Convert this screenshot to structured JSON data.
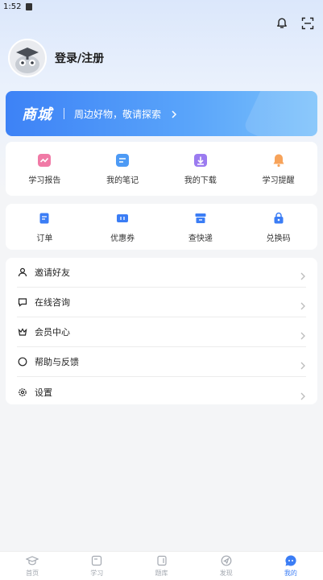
{
  "status_bar": {
    "time": "1:52"
  },
  "profile": {
    "login_label": "登录/注册"
  },
  "mall": {
    "title": "商城",
    "subtitle": "周边好物，敬请探索"
  },
  "quick_grid": [
    {
      "label": "学习报告",
      "icon": "report-icon",
      "color": "#f07aa6"
    },
    {
      "label": "我的笔记",
      "icon": "notes-icon",
      "color": "#4d9af5"
    },
    {
      "label": "我的下载",
      "icon": "download-icon",
      "color": "#9b7bf0"
    },
    {
      "label": "学习提醒",
      "icon": "bell-icon",
      "color": "#f7a35a"
    }
  ],
  "order_grid": [
    {
      "label": "订单",
      "icon": "order-icon"
    },
    {
      "label": "优惠券",
      "icon": "coupon-icon"
    },
    {
      "label": "查快递",
      "icon": "express-icon"
    },
    {
      "label": "兑换码",
      "icon": "redeem-icon"
    }
  ],
  "menu": [
    {
      "label": "邀请好友",
      "icon": "person-icon"
    },
    {
      "label": "在线咨询",
      "icon": "chat-icon"
    },
    {
      "label": "会员中心",
      "icon": "crown-icon"
    },
    {
      "label": "帮助与反馈",
      "icon": "help-icon"
    },
    {
      "label": "设置",
      "icon": "settings-icon"
    }
  ],
  "tabs": [
    {
      "label": "首页",
      "icon": "graduation-cap-icon",
      "active": false
    },
    {
      "label": "学习",
      "icon": "study-icon",
      "active": false
    },
    {
      "label": "题库",
      "icon": "question-bank-icon",
      "active": false
    },
    {
      "label": "发现",
      "icon": "discover-icon",
      "active": false
    },
    {
      "label": "我的",
      "icon": "profile-chat-icon",
      "active": true
    }
  ],
  "colors": {
    "accent": "#3b7df5",
    "tab_inactive": "#a3a8b0",
    "order_icon": "#3b7df5"
  }
}
